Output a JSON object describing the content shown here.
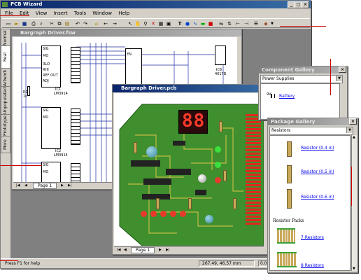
{
  "app": {
    "title": "PCB Wizard",
    "menu": [
      "File",
      "Edit",
      "View",
      "Insert",
      "Tools",
      "Window",
      "Help"
    ]
  },
  "side_tabs": [
    "Normal",
    "Real World",
    "Artwork",
    "Unpopulated",
    "Prototype",
    "More"
  ],
  "schematic": {
    "title": "Bargraph Driver.fsw",
    "page_label": "Page 1",
    "labels": [
      "IC1",
      "LM3914",
      "IC2",
      "LM3914",
      "IC3",
      "LM3914",
      "IC6",
      "4017B",
      "R1",
      "1k",
      "SIG",
      "RLO",
      "RHI",
      "REF OUT",
      "ADJ",
      "MO",
      "EN",
      "V-",
      "V+"
    ]
  },
  "pcb": {
    "title": "Bargraph Driver.pcb",
    "page_label": "Page 1",
    "display": "88"
  },
  "component_gallery": {
    "title": "Component Gallery",
    "category": "Power Supplies",
    "items": [
      {
        "label": "9V",
        "name": "Battery"
      }
    ]
  },
  "package_gallery": {
    "title": "Package Gallery",
    "category": "Resistors",
    "items": [
      "Resistor (0.4 in)",
      "Resistor (0.5 in)",
      "Resistor (0.6 in)"
    ],
    "section": "Resistor Packs",
    "packs": [
      "7 Resistors",
      "8 Resistors"
    ]
  },
  "status": {
    "help": "Press F1 for help",
    "coords": "267.49, 46.57 mm",
    "zoom": "0.05"
  },
  "colors": {
    "titlebar": "#0a246a",
    "callout": "#cc0000",
    "pcb_board": "#3f8f2e"
  }
}
